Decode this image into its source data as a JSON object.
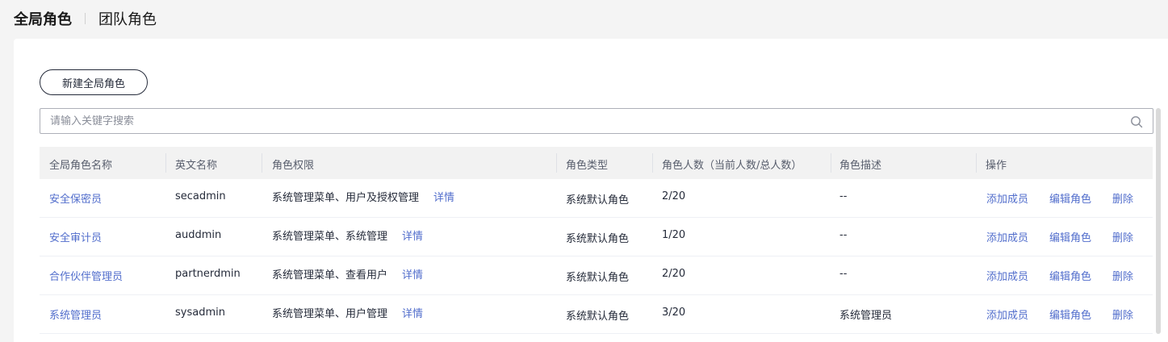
{
  "tabs": {
    "active": "全局角色",
    "other": "团队角色"
  },
  "new_button": "新建全局角色",
  "search": {
    "placeholder": "请输入关键字搜索"
  },
  "columns": [
    "全局角色名称",
    "英文名称",
    "角色权限",
    "角色类型",
    "角色人数（当前人数/总人数）",
    "角色描述",
    "操作"
  ],
  "rows": [
    {
      "name": "安全保密员",
      "en": "secadmin",
      "perm": "系统管理菜单、用户及授权管理",
      "detail": "详情",
      "type": "系统默认角色",
      "count": "2/20",
      "desc": "--",
      "add": "添加成员",
      "edit": "编辑角色",
      "del": "删除"
    },
    {
      "name": "安全审计员",
      "en": "auddmin",
      "perm": "系统管理菜单、系统管理",
      "detail": "详情",
      "type": "系统默认角色",
      "count": "1/20",
      "desc": "--",
      "add": "添加成员",
      "edit": "编辑角色",
      "del": "删除"
    },
    {
      "name": "合作伙伴管理员",
      "en": "partnerdmin",
      "perm": "系统管理菜单、查看用户",
      "detail": "详情",
      "type": "系统默认角色",
      "count": "2/20",
      "desc": "--",
      "add": "添加成员",
      "edit": "编辑角色",
      "del": "删除"
    },
    {
      "name": "系统管理员",
      "en": "sysadmin",
      "perm": "系统管理菜单、用户管理",
      "detail": "详情",
      "type": "系统默认角色",
      "count": "3/20",
      "desc": "系统管理员",
      "add": "添加成员",
      "edit": "编辑角色",
      "del": "删除"
    }
  ],
  "colors": {
    "link": "#526ecc",
    "header_bg": "#f2f2f2"
  }
}
